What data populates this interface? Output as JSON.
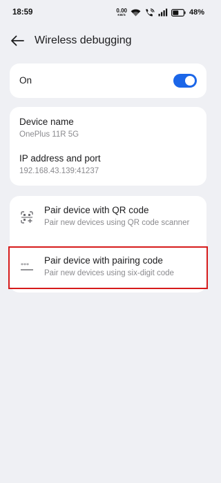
{
  "status_bar": {
    "time": "18:59",
    "net_speed_value": "0.00",
    "net_speed_unit": "KB/S",
    "battery": "48%"
  },
  "header": {
    "title": "Wireless debugging"
  },
  "toggle": {
    "label": "On",
    "state": "on",
    "accent": "#1b66e8"
  },
  "device_info": {
    "name_title": "Device name",
    "name_value": "OnePlus 11R 5G",
    "ip_title": "IP address and port",
    "ip_value": "192.168.43.139:41237"
  },
  "pairing": {
    "qr": {
      "title": "Pair device with QR code",
      "subtitle": "Pair new devices using QR code scanner",
      "icon": "qr-scan-icon"
    },
    "code": {
      "title": "Pair device with pairing code",
      "subtitle": "Pair new devices using six-digit code",
      "icon": "password-icon"
    }
  },
  "highlight_color": "#d61a1a"
}
